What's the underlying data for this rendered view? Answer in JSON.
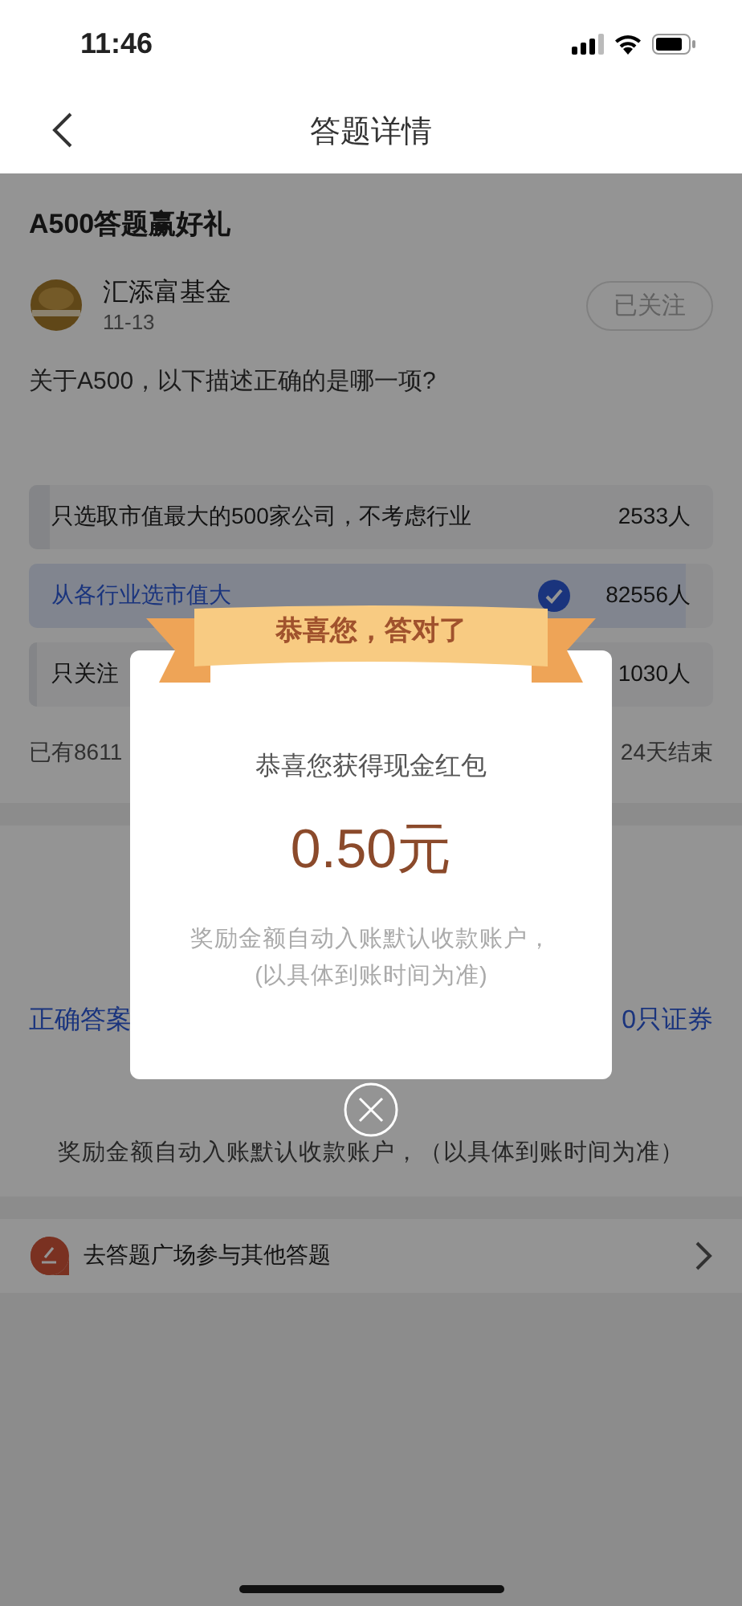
{
  "status_bar": {
    "time": "11:46"
  },
  "nav": {
    "title": "答题详情"
  },
  "post": {
    "title": "A500答题赢好礼",
    "author": "汇添富基金",
    "date": "11-13",
    "follow_label": "已关注",
    "followed": true
  },
  "question": "关于A500，以下描述正确的是哪一项?",
  "options": [
    {
      "text": "只选取市值最大的500家公司，不考虑行业",
      "count": "2533人",
      "level": 0.03,
      "correct": false
    },
    {
      "text": "从各行业选市值大",
      "count": "82556人",
      "level": 0.96,
      "correct": true
    },
    {
      "text": "只关注",
      "count": "1030人",
      "level": 0.012,
      "correct": false
    }
  ],
  "stats": {
    "participants": "已有8611",
    "ends": "24天结束"
  },
  "answer": {
    "label": "正确答案",
    "tail": "0只证券",
    "note": "奖励金额自动入账默认收款账户，（以具体到账时间为准）"
  },
  "more_link": "去答题广场参与其他答题",
  "dialog": {
    "banner": "恭喜您，答对了",
    "headline": "恭喜您获得现金红包",
    "amount": "0.50元",
    "note_lines": [
      "奖励金额自动入账默认收款账户，",
      "(以具体到账时间为准)"
    ]
  }
}
